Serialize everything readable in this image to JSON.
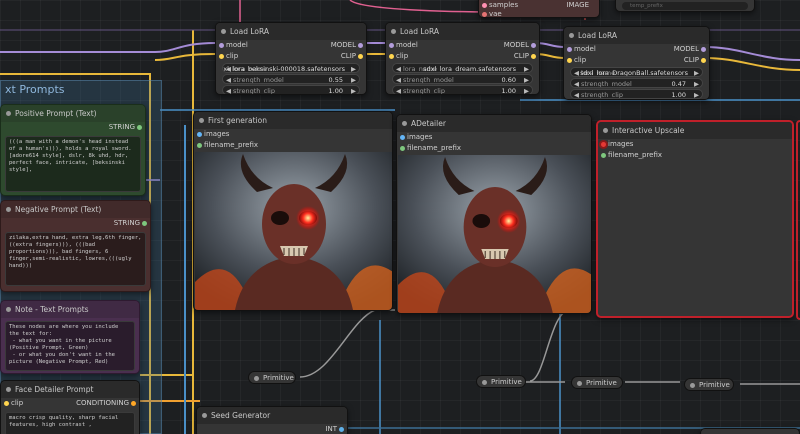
{
  "colors": {
    "model": "#b39ddb",
    "clip": "#ffd54f",
    "image": "#64b5f6",
    "string": "#7ec77e",
    "conditioning": "#ffa726",
    "int": "#5fb0e8",
    "vae": "#e57373",
    "latent": "#ff8fb0"
  },
  "group_text_prompts": {
    "title": "xt Prompts"
  },
  "top_node": {
    "outputs": [
      "samples",
      "vae"
    ],
    "image_label": "IMAGE",
    "hint": "temp_prefix"
  },
  "lora1": {
    "title": "Load LoRA",
    "inputs": [
      "model",
      "clip"
    ],
    "outputs": [
      "MODEL",
      "CLIP"
    ],
    "lora_name_key": "lora_name",
    "lora_name": "sdxl_lora_beksinski-000018.safetensors",
    "strength_model_label": "strength_model",
    "strength_model": "0.55",
    "strength_clip_label": "strength_clip",
    "strength_clip": "1.00"
  },
  "lora2": {
    "title": "Load LoRA",
    "inputs": [
      "model",
      "clip"
    ],
    "outputs": [
      "MODEL",
      "CLIP"
    ],
    "lora_name_key": "lora_name",
    "lora_name": "sdxl_lora_dream.safetensors",
    "strength_model_label": "strength_model",
    "strength_model": "0.60",
    "strength_clip_label": "strength_clip",
    "strength_clip": "1.00"
  },
  "lora3": {
    "title": "Load LoRA",
    "inputs": [
      "model",
      "clip"
    ],
    "outputs": [
      "MODEL",
      "CLIP"
    ],
    "lora_name_key": "lora_name",
    "lora_name": "sdxl_lora_DragonBall.safetensors",
    "strength_model_label": "strength_model",
    "strength_model": "0.47",
    "strength_clip_label": "strength_clip",
    "strength_clip": "1.00"
  },
  "positive_prompt": {
    "title": "Positive Prompt (Text)",
    "output": "STRING",
    "text": "(((a man with a demon's head instead of a human's))), holds a royal sword. [adore614 style], dslr, 8k uhd, hdr, perfect face, intricate, [beksinski style],"
  },
  "negative_prompt": {
    "title": "Negative Prompt (Text)",
    "output": "STRING",
    "text": "zilaka,extra hand, extra leg,6th finger, ((extra fingers))), (((bad proportions))), bad fingers, 6 finger,semi-realistic, lowres,(((ugly hand)))"
  },
  "note": {
    "title": "Note - Text Prompts",
    "text": "These nodes are where you include the text for:\n - what you want in the picture (Positive Prompt, Green)\n - or what you don't want in the picture (Negative Prompt, Red)\n\nThis node type is called a \"PrimitiveNode\" if you are searching for the node type."
  },
  "face_detailer": {
    "title": "Face Detailer Prompt",
    "input": "clip",
    "output": "CONDITIONING",
    "text": "macro crisp quality, sharp facial features, high contrast ,"
  },
  "first_generation": {
    "title": "First generation",
    "inputs": [
      "images",
      "filename_prefix"
    ]
  },
  "adetailer": {
    "title": "ADetailer",
    "inputs": [
      "images",
      "filename_prefix"
    ]
  },
  "upscale": {
    "title": "Interactive Upscale",
    "inputs": [
      "images",
      "filename_prefix"
    ]
  },
  "primitives": [
    "Primitive",
    "Primitive",
    "Primitive",
    "Primitive"
  ],
  "seed": {
    "title": "Seed Generator",
    "output": "INT"
  }
}
